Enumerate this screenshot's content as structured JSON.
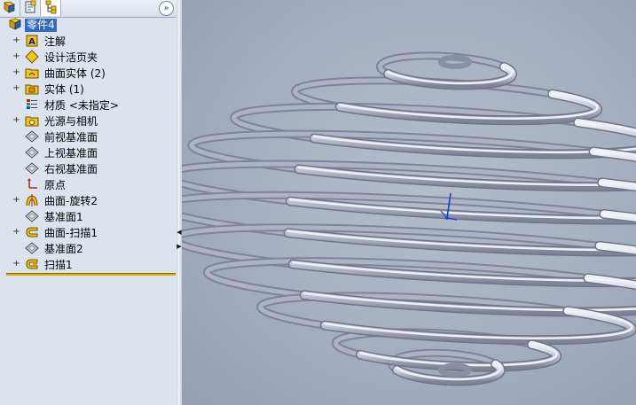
{
  "feature_manager": {
    "tabs": [
      {
        "icon": "feature-tree-icon",
        "active": false
      },
      {
        "icon": "property-manager-icon",
        "active": false
      },
      {
        "icon": "configuration-manager-icon",
        "active": true
      }
    ],
    "expand_icon": "»",
    "root_label": "零件4",
    "items": [
      {
        "label": "注解",
        "icon": "annotations-icon",
        "expandable": true
      },
      {
        "label": "设计活页夹",
        "icon": "design-binder-icon",
        "expandable": true
      },
      {
        "label": "曲面实体 (2)",
        "icon": "surface-bodies-icon",
        "expandable": true
      },
      {
        "label": "实体 (1)",
        "icon": "solid-bodies-icon",
        "expandable": true
      },
      {
        "label": "材质 <未指定>",
        "icon": "material-icon",
        "expandable": false
      },
      {
        "label": "光源与相机",
        "icon": "lights-cameras-icon",
        "expandable": true
      },
      {
        "label": "前视基准面",
        "icon": "plane-icon",
        "expandable": false
      },
      {
        "label": "上视基准面",
        "icon": "plane-icon",
        "expandable": false
      },
      {
        "label": "右视基准面",
        "icon": "plane-icon",
        "expandable": false
      },
      {
        "label": "原点",
        "icon": "origin-icon",
        "expandable": false
      },
      {
        "label": "曲面-旋转2",
        "icon": "surface-revolve-icon",
        "expandable": true
      },
      {
        "label": "基准面1",
        "icon": "plane-icon",
        "expandable": false
      },
      {
        "label": "曲面-扫描1",
        "icon": "surface-sweep-icon",
        "expandable": true
      },
      {
        "label": "基准面2",
        "icon": "plane-icon",
        "expandable": false
      },
      {
        "label": "扫描1",
        "icon": "sweep-icon",
        "expandable": true
      }
    ]
  },
  "graphics_area": {
    "model": "spherical-helix-spring",
    "coil_color": "#c3c8dc",
    "coil_shade": "#7f8499",
    "axis_color": "#1a3fd6"
  },
  "colors": {
    "selection": "#3169c6",
    "panel_bg": "#dce3ec",
    "rollback_bar": "#d8b200"
  }
}
